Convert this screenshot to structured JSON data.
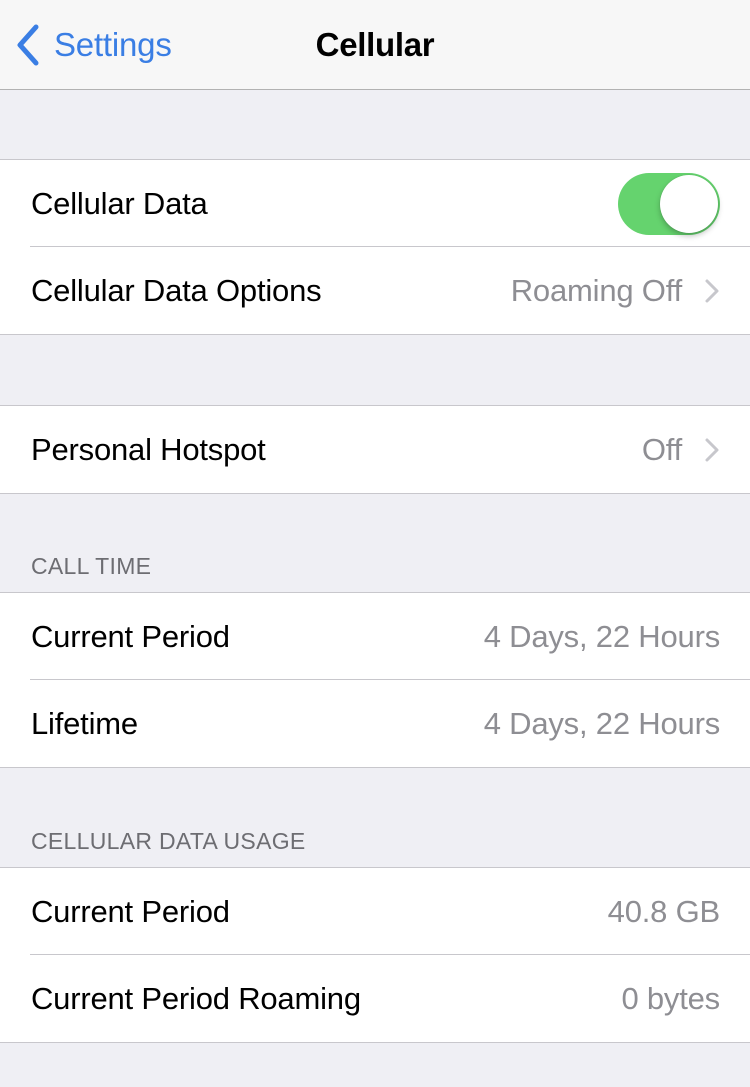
{
  "navbar": {
    "back_label": "Settings",
    "title": "Cellular"
  },
  "accent_color": "#3a7ee4",
  "toggle_on_color": "#65d36e",
  "group1": {
    "cellular_data": {
      "label": "Cellular Data",
      "toggle_on": true
    },
    "cellular_data_options": {
      "label": "Cellular Data Options",
      "value": "Roaming Off"
    }
  },
  "group2": {
    "personal_hotspot": {
      "label": "Personal Hotspot",
      "value": "Off"
    }
  },
  "call_time": {
    "header": "CALL TIME",
    "rows": [
      {
        "label": "Current Period",
        "value": "4 Days, 22 Hours"
      },
      {
        "label": "Lifetime",
        "value": "4 Days, 22 Hours"
      }
    ]
  },
  "data_usage": {
    "header": "CELLULAR DATA USAGE",
    "rows": [
      {
        "label": "Current Period",
        "value": "40.8 GB"
      },
      {
        "label": "Current Period Roaming",
        "value": "0 bytes"
      }
    ]
  }
}
